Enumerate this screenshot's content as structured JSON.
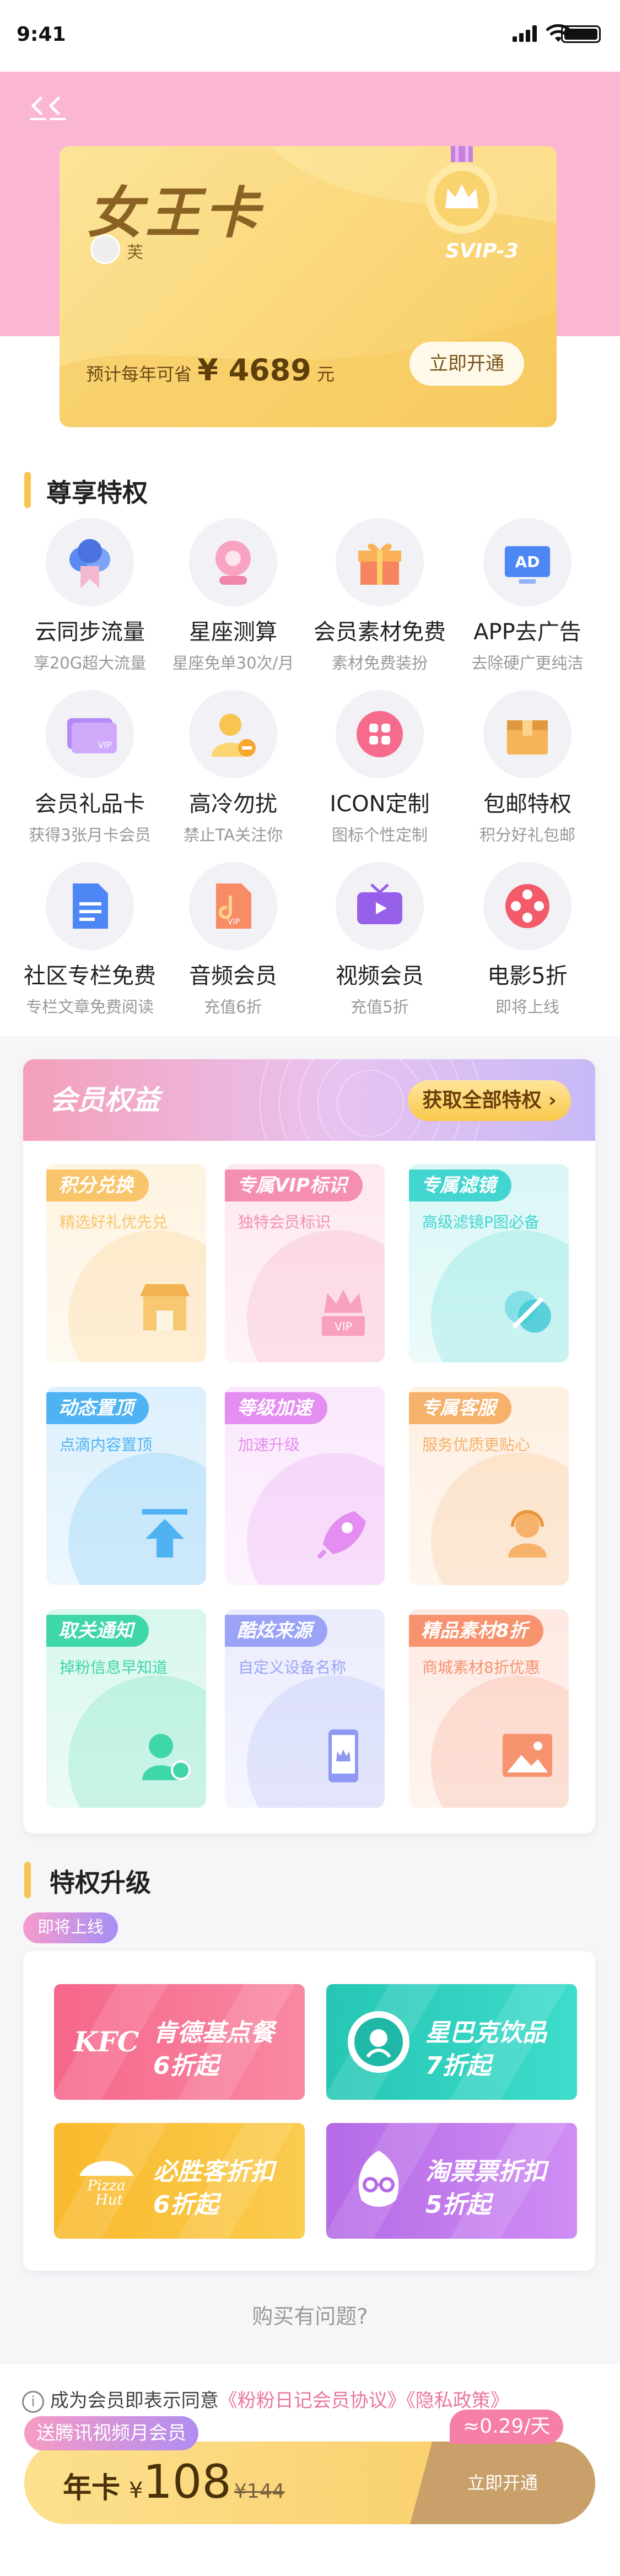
{
  "status_bar": {
    "time": "9:41"
  },
  "hero": {
    "card_title": "女王卡",
    "user_name": "芙",
    "level": "SVIP-3",
    "save_prefix": "预计每年可省",
    "save_currency": "¥",
    "save_amount": "4689",
    "save_unit": "元",
    "open_button": "立即开通"
  },
  "privileges": {
    "title": "尊享特权",
    "items": [
      {
        "title": "云同步流量",
        "desc": "享20G超大流量",
        "icon": "cloud-sync-icon"
      },
      {
        "title": "星座测算",
        "desc": "星座免单30次/月",
        "icon": "crystal-ball-icon"
      },
      {
        "title": "会员素材免费",
        "desc": "素材免费装扮",
        "icon": "gift-icon"
      },
      {
        "title": "APP去广告",
        "desc": "去除硬广更纯洁",
        "icon": "ad-icon"
      },
      {
        "title": "会员礼品卡",
        "desc": "获得3张月卡会员",
        "icon": "vip-card-icon"
      },
      {
        "title": "高冷勿扰",
        "desc": "禁止TA关注你",
        "icon": "do-not-disturb-icon"
      },
      {
        "title": "ICON定制",
        "desc": "图标个性定制",
        "icon": "icon-custom-icon"
      },
      {
        "title": "包邮特权",
        "desc": "积分好礼包邮",
        "icon": "package-icon"
      },
      {
        "title": "社区专栏免费",
        "desc": "专栏文章免费阅读",
        "icon": "document-icon"
      },
      {
        "title": "音频会员",
        "desc": "充值6折",
        "icon": "audio-file-icon"
      },
      {
        "title": "视频会员",
        "desc": "充值5折",
        "icon": "tv-icon"
      },
      {
        "title": "电影5折",
        "desc": "即将上线",
        "icon": "film-reel-icon"
      }
    ]
  },
  "benefits": {
    "title": "会员权益",
    "all_button": "获取全部特权 ›",
    "items": [
      {
        "tag": "积分兑换",
        "desc": "精选好礼优先兑",
        "icon": "store-icon",
        "color": "#f9c56a"
      },
      {
        "tag": "专属VIP标识",
        "desc": "独特会员标识",
        "icon": "crown-vip-icon",
        "color": "#f58fb1"
      },
      {
        "tag": "专属滤镜",
        "desc": "高级滤镜P图必备",
        "icon": "filter-icon",
        "color": "#43d6d0"
      },
      {
        "tag": "动态置顶",
        "desc": "点滴内容置顶",
        "icon": "pin-top-icon",
        "color": "#4fb3f3"
      },
      {
        "tag": "等级加速",
        "desc": "加速升级",
        "icon": "rocket-icon",
        "color": "#e58ef1"
      },
      {
        "tag": "专属客服",
        "desc": "服务优质更贴心",
        "icon": "support-agent-icon",
        "color": "#f6b16a"
      },
      {
        "tag": "取关通知",
        "desc": "掉粉信息早知道",
        "icon": "user-notify-icon",
        "color": "#3fd6a9"
      },
      {
        "tag": "酷炫来源",
        "desc": "自定义设备名称",
        "icon": "phone-crown-icon",
        "color": "#9aa3f5"
      },
      {
        "tag": "精品素材8折",
        "desc": "商城素材8折优惠",
        "icon": "image-icon",
        "color": "#f7936f"
      }
    ]
  },
  "upgrade": {
    "title": "特权升级",
    "badge": "即将上线",
    "items": [
      {
        "name": "肯德基点餐",
        "discount": "6折起",
        "logo": "KFC",
        "icon": "kfc-logo-icon"
      },
      {
        "name": "星巴克饮品",
        "discount": "7折起",
        "logo": "starbucks",
        "icon": "starbucks-logo-icon"
      },
      {
        "name": "必胜客折扣",
        "discount": "6折起",
        "logo": "Pizza Hut",
        "icon": "pizzahut-logo-icon"
      },
      {
        "name": "淘票票折扣",
        "discount": "5折起",
        "logo": "taopiaopiao",
        "icon": "taopiaopiao-logo-icon"
      }
    ]
  },
  "help": {
    "text": "购买有问题?"
  },
  "agreement": {
    "prefix": "成为会员即表示同意",
    "link1": "《粉粉日记会员协议》",
    "link2": "《隐私政策》"
  },
  "purchase": {
    "gift_badge": "送腾讯视频月会员",
    "per_day": "≈0.29/天",
    "plan": "年卡",
    "currency": "¥",
    "price": "108",
    "original": "¥144",
    "button": "立即开通"
  },
  "colors": {
    "accent": "#f9c44f",
    "pink": "#fbb6d3",
    "gold_text": "#8a6224"
  }
}
